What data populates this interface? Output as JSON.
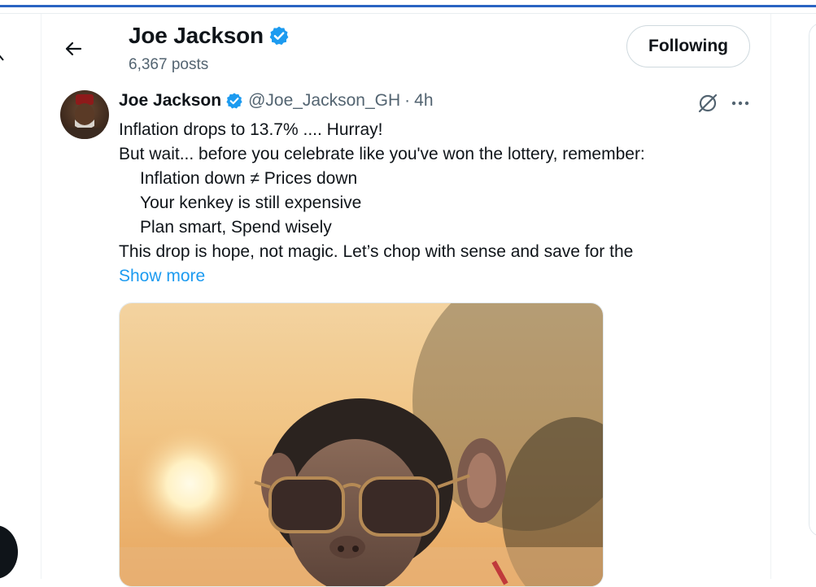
{
  "header": {
    "name": "Joe Jackson",
    "post_count": "6,367 posts",
    "follow_label": "Following"
  },
  "tweet": {
    "author_name": "Joe Jackson",
    "handle": "@Joe_Jackson_GH",
    "separator": "·",
    "time": "4h",
    "lines": [
      "Inflation drops to 13.7% .... Hurray!",
      "But wait... before you celebrate like you've won the lottery, remember:",
      "Inflation down ≠ Prices down",
      "Your kenkey is still expensive",
      "Plan smart, Spend wisely",
      "This drop is hope, not magic. Let’s chop with sense and save for the"
    ],
    "show_more": "Show more",
    "media": {
      "description_icon": "photo-chimpanzee-sunglasses"
    }
  },
  "icons": {
    "back": "back-arrow-icon",
    "verified": "verified-badge-icon",
    "grok": "grok-icon",
    "more": "more-options-icon"
  },
  "colors": {
    "accent": "#1d9bf0",
    "text": "#0f1419",
    "muted": "#536471",
    "top_bar": "#2a64c2"
  }
}
